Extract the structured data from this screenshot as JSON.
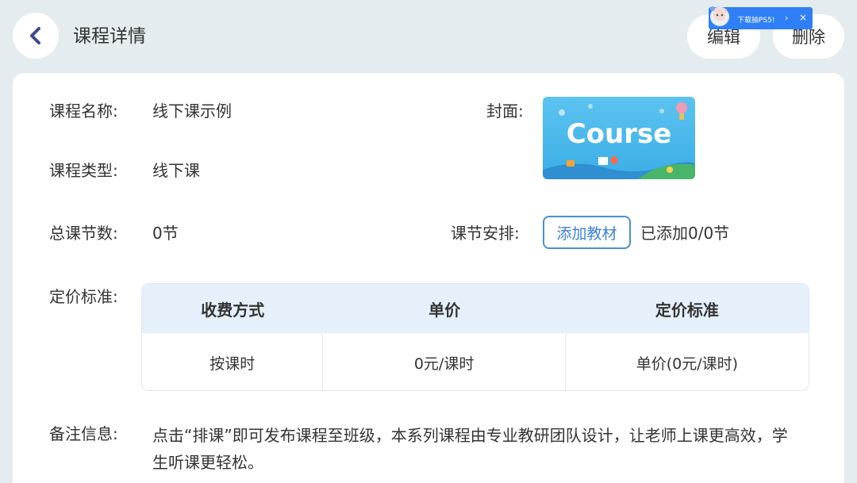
{
  "header": {
    "title": "课程详情",
    "edit_label": "编辑",
    "delete_label": "删除"
  },
  "ad": {
    "text": "下载抽PS5!",
    "arrow": "›",
    "close": "×"
  },
  "details": {
    "course_name_label": "课程名称:",
    "course_name": "线下课示例",
    "course_type_label": "课程类型:",
    "course_type": "线下课",
    "total_sessions_label": "总课节数:",
    "total_sessions": "0节",
    "cover_label": "封面:",
    "cover_text": "Course",
    "schedule_label": "课节安排:",
    "add_material_label": "添加教材",
    "added_status": "已添加0/0节",
    "pricing_label": "定价标准:"
  },
  "pricing_table": {
    "headers": [
      "收费方式",
      "单价",
      "定价标准"
    ],
    "rows": [
      [
        "按课时",
        "0元/课时",
        "单价(0元/课时)"
      ]
    ]
  },
  "remark": {
    "label": "备注信息:",
    "text": "点击“排课”即可发布课程至班级，本系列课程由专业教研团队设计，让老师上课更高效，学生听课更轻松。"
  },
  "colors": {
    "page_bg": "#e4ecef",
    "accent_blue": "#3b82d6",
    "table_header_bg": "#e6f0fb",
    "ad_bg": "#2f80f7"
  },
  "icons": {
    "back": "chevron-left-icon",
    "ad_close": "close-icon"
  }
}
